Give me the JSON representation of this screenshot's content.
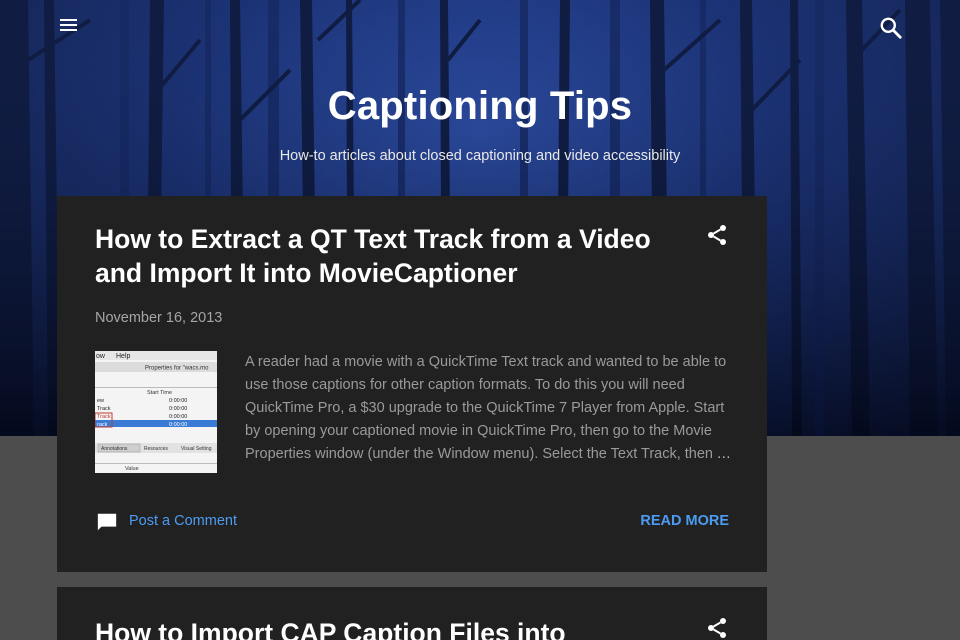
{
  "header": {
    "menu_icon": "menu-icon",
    "search_icon": "search-icon",
    "title": "Captioning Tips",
    "description": "How-to articles about closed captioning and video accessibility"
  },
  "posts": [
    {
      "title": "How to Extract a QT Text Track from a Video and Import It into MovieCaptioner",
      "date": "November 16, 2013",
      "snippet": "A reader had a movie with a QuickTime Text track and wanted to be able to use those captions for other caption formats. To do this you will need QuickTime Pro, a $30 upgrade to the QuickTime 7 Player from Apple. Start by opening your captioned movie in QuickTime Pro, then go to the Movie Properties window (under the Window menu). Select the Text Track, then",
      "ellipsis": "…",
      "comment_label": "Post a Comment",
      "read_more_label": "READ MORE",
      "share_icon": "share-icon",
      "comment_icon": "comment-icon",
      "thumbnail": {
        "menu_items": [
          "ow",
          "Help"
        ],
        "window_title": "Properties for \"wacs.mo",
        "column_header": "Start Time",
        "rows": [
          {
            "name": "ew",
            "time": "0:00:00"
          },
          {
            "name": "Track",
            "time": "0:00:00"
          },
          {
            "name": "Track",
            "time": "0:00:00"
          },
          {
            "name": "rack",
            "time": "0:00:00"
          }
        ],
        "tabs": [
          "Annotations",
          "Resources",
          "Visual Setting"
        ],
        "value_label": "Value"
      }
    },
    {
      "title": "How to Import CAP Caption Files into",
      "share_icon": "share-icon"
    }
  ],
  "colors": {
    "card_bg": "#212121",
    "link": "#4c9cf2",
    "page_bg": "#4d4d4d"
  }
}
